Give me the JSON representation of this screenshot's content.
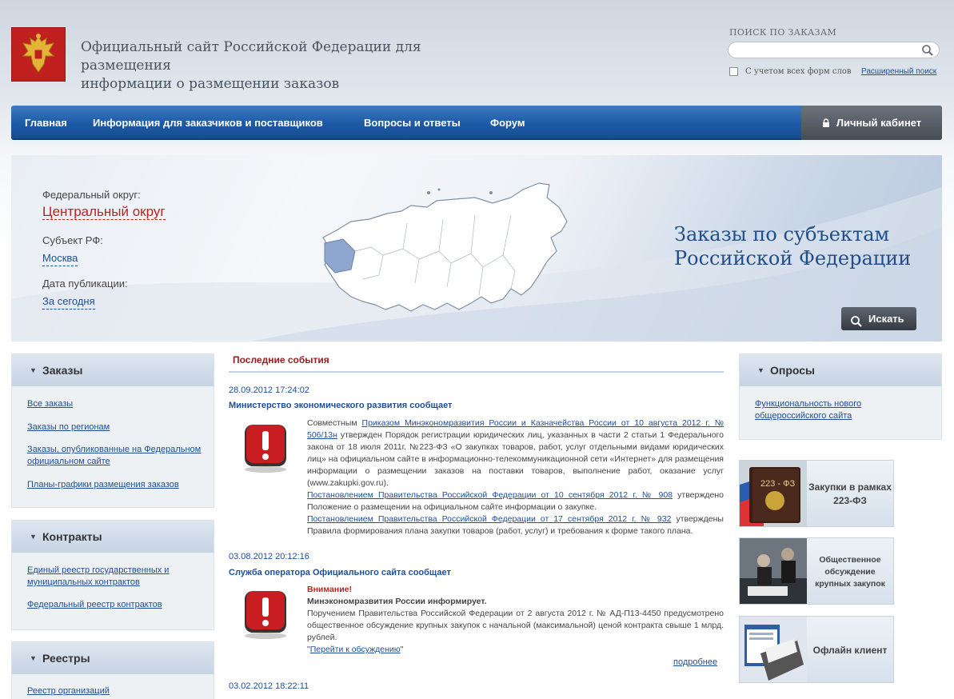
{
  "header": {
    "title_line1": "Официальный сайт Российской Федерации для размещения",
    "title_line2": "информации о размещении заказов",
    "search_label": "ПОИСК ПО ЗАКАЗАМ",
    "search_value": "",
    "morph_label": "С учетом всех форм слов",
    "advanced_search": "Расширенный поиск"
  },
  "nav": {
    "items": [
      "Главная",
      "Информация для заказчиков и поставщиков",
      "Вопросы и ответы",
      "Форум"
    ],
    "cabinet": "Личный кабинет"
  },
  "banner": {
    "district_label": "Федеральный округ:",
    "district_value": "Центральный округ",
    "subject_label": "Субъект РФ:",
    "subject_value": "Москва",
    "date_label": "Дата публикации:",
    "date_value": "За сегодня",
    "title_line1": "Заказы по субъектам",
    "title_line2": "Российской Федерации",
    "search_button": "Искать"
  },
  "left": {
    "orders": {
      "title": "Заказы",
      "links": [
        "Все заказы",
        "Заказы по регионам",
        "Заказы, опубликованные на Федеральном официальном сайте",
        "Планы-графики размещения заказов"
      ]
    },
    "contracts": {
      "title": "Контракты",
      "links": [
        "Единый реестр государственных и муниципальных контрактов",
        "Федеральный реестр контрактов"
      ]
    },
    "registries": {
      "title": "Реестры",
      "links": [
        "Реестр организаций"
      ]
    }
  },
  "news": {
    "title": "Последние события",
    "items": [
      {
        "date": "28.09.2012 17:24:02",
        "head": "Министерство экономического развития сообщает",
        "p1_pre": "Совместным ",
        "p1_link": "Приказом Минэкономразвития России и Казначейства России от 10 августа 2012 г. № 506/13н",
        "p1_post": " утвержден Порядок регистрации юридических лиц, указанных в части 2 статьи 1 Федерального закона от 18 июля 2011г. №223-ФЗ «О закупках товаров, работ, услуг отдельными видами юридических лиц» на официальном сайте в информационно-телекоммуникационной сети «Интернет» для размещения информации о размещении заказов на поставки товаров, выполнение работ, оказание услуг (www.zakupki.gov.ru).",
        "p2_link": "Постановлением Правительства Российской Федерации от 10 сентября 2012 г. № 908",
        "p2_post": " утверждено Положение о размещении на официальном сайте информации о закупке.",
        "p3_link": "Постановлением Правительства Российской Федерации от 17 сентября 2012 г. № 932",
        "p3_post": " утверждены Правила формирования плана закупки товаров (работ, услуг) и требования к форме такого плана."
      },
      {
        "date": "03.08.2012 20:12:16",
        "head": "Служба оператора Официального сайта сообщает",
        "attention": "Внимание!",
        "subhead": "Минэкономразвития России информирует.",
        "body": "Поручением Правительства Российской Федерации от 2 августа 2012 г. № АД-П13-4450 предусмотрено общественное обсуждение крупных закупок с начальной (максимальной) ценой контракта свыше 1 млрд. рублей.",
        "quote_open": "\"",
        "link": "Перейти к обсуждению",
        "quote_close": "\"",
        "more": "подробнее"
      },
      {
        "date": "03.02.2012 18:22:11"
      }
    ]
  },
  "right": {
    "polls": {
      "title": "Опросы",
      "link": "Функциональность нового общероссийского сайта"
    },
    "promos": [
      "Закупки в рамках 223-ФЗ",
      "Общественное обсуждение крупных закупок",
      "Офлайн клиент"
    ],
    "promo_badge": "223 - ФЗ"
  },
  "colors": {
    "nav": "#1d5aa6",
    "accent_red": "#9a1b1b",
    "link": "#1f4e9a"
  }
}
